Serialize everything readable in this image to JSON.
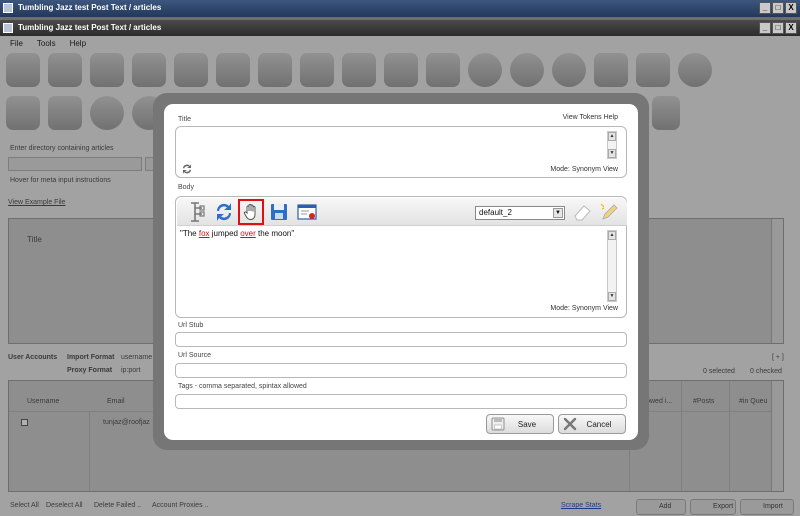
{
  "outer_window": {
    "title": "Tumbling Jazz test Post Text / articles"
  },
  "inner_window": {
    "title": "Tumbling Jazz test Post Text / articles"
  },
  "window_buttons": {
    "minimize": "_",
    "maximize": "□",
    "close": "X"
  },
  "menu": [
    "File",
    "Tools",
    "Help"
  ],
  "background": {
    "dir_label": "Enter directory containing articles",
    "hover_hint": "Hover for meta input instructions",
    "view_example": "View Example File",
    "grid_title_header": "Title",
    "user_accounts_label": "User Accounts",
    "import_format_label": "Import Format",
    "import_format_value": "username",
    "proxy_format_label": "Proxy Format",
    "proxy_format_value": "ip:port",
    "expand": "[ + ]",
    "selected_count": "0 selected",
    "checked_count": "0 checked",
    "col_username": "Username",
    "col_email": "Email",
    "col_followed": "llowed i...",
    "col_posts": "#Posts",
    "col_queue": "#in Queu",
    "row_email": "tunjaz@roofjaz",
    "bottom_links": [
      "Select All",
      "Deselect All",
      "Delete Failed ..",
      "Account Proxies .."
    ],
    "scrape_stats": "Scrape Stats",
    "btn_add": "Add",
    "btn_export": "Export",
    "btn_import": "Import"
  },
  "modal": {
    "title_label": "Title",
    "view_tokens_help": "View Tokens Help",
    "title_mode": "Mode:  Synonym View",
    "body_label": "Body",
    "spinner_select": "default_2",
    "body_text": {
      "part1": "\"The ",
      "spin1": "fox",
      "part2": " jumped ",
      "spin2": "over",
      "part3": " the moon\""
    },
    "body_mode": "Mode:  Synonym View",
    "url_stub_label": "Url Stub",
    "url_source_label": "Url Source",
    "tags_label": "Tags - comma separated, spintax allowed",
    "save_label": "Save",
    "cancel_label": "Cancel"
  },
  "colors": {
    "highlight": "#e01010",
    "spin_word": "#d01010",
    "title_bar": "#2c3f63"
  }
}
